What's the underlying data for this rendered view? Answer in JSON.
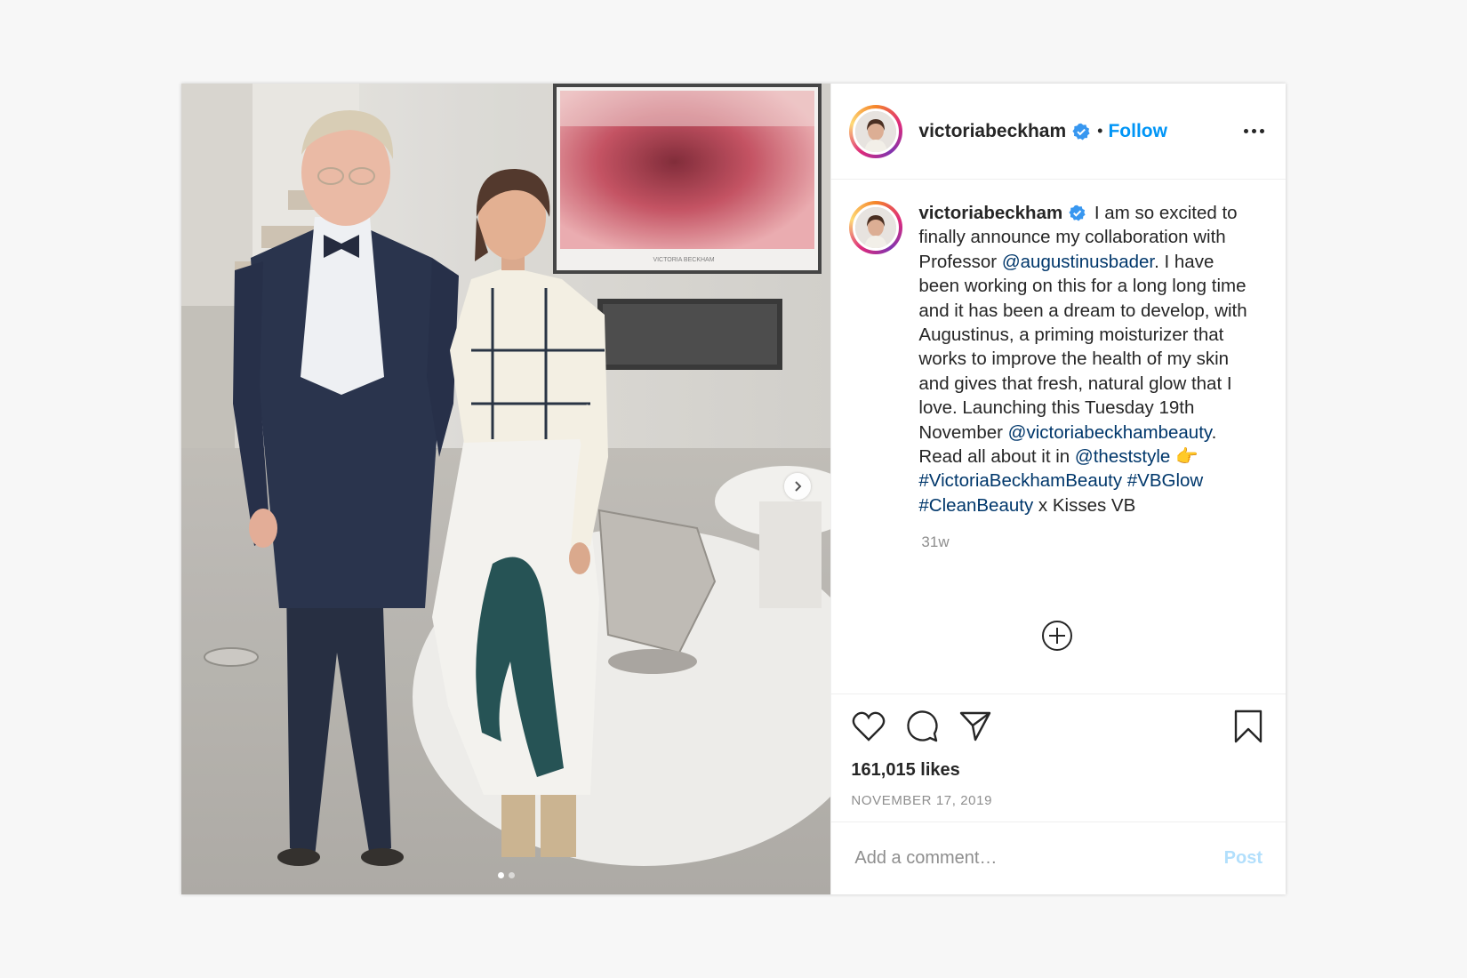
{
  "post": {
    "username": "victoriabeckham",
    "verified": true,
    "separator": "•",
    "follow_label": "Follow",
    "more_icon": "more-options-icon",
    "caption": {
      "username": "victoriabeckham",
      "segments": [
        {
          "text": " I am so excited to finally announce my collaboration with Professor ",
          "type": "text"
        },
        {
          "text": "@augustinusbader",
          "type": "mention"
        },
        {
          "text": ". I have been working on this for a long long time and it has been a dream to develop, with Augustinus, a priming moisturizer that works to improve the health of my skin and gives that fresh, natural glow that I love. Launching this Tuesday 19th November ",
          "type": "text"
        },
        {
          "text": "@victoriabeckhambeauty",
          "type": "mention"
        },
        {
          "text": ". Read all about it in ",
          "type": "text"
        },
        {
          "text": "@theststyle",
          "type": "mention"
        },
        {
          "text": " 👉 ",
          "type": "text"
        },
        {
          "text": "#VictoriaBeckhamBeauty",
          "type": "mention"
        },
        {
          "text": " ",
          "type": "text"
        },
        {
          "text": "#VBGlow",
          "type": "mention"
        },
        {
          "text": " ",
          "type": "text"
        },
        {
          "text": "#CleanBeauty",
          "type": "mention"
        },
        {
          "text": " x Kisses VB",
          "type": "text"
        }
      ],
      "age": "31w"
    },
    "likes": "161,015 likes",
    "date": "NOVEMBER 17, 2019",
    "comment_placeholder": "Add a comment…",
    "post_label": "Post",
    "carousel": {
      "count": 2,
      "active": 0
    },
    "colors": {
      "accent": "#0095f6",
      "mention": "#00376b",
      "muted": "#8e8e8e",
      "post_disabled": "#b2dffc"
    },
    "icons": [
      "like-heart-icon",
      "comment-icon",
      "share-icon",
      "save-bookmark-icon",
      "load-more-comments-icon",
      "verified-badge-icon",
      "carousel-next-icon"
    ]
  }
}
